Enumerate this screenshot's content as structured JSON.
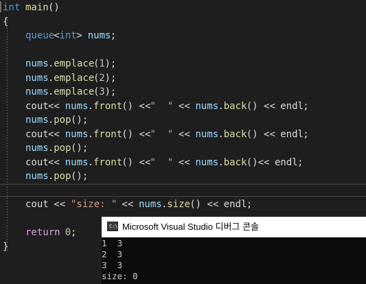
{
  "editor": {
    "lines": [
      {
        "tokens": [
          {
            "t": "int",
            "c": "kw"
          },
          {
            "t": " ",
            "c": "plain"
          },
          {
            "t": "main",
            "c": "fn"
          },
          {
            "t": "()",
            "c": "plain"
          }
        ]
      },
      {
        "tokens": [
          {
            "t": "{",
            "c": "plain"
          }
        ]
      },
      {
        "tokens": [
          {
            "t": "    ",
            "c": "plain"
          },
          {
            "t": "queue",
            "c": "kw"
          },
          {
            "t": "<",
            "c": "plain"
          },
          {
            "t": "int",
            "c": "kw"
          },
          {
            "t": "> ",
            "c": "plain"
          },
          {
            "t": "nums",
            "c": "var"
          },
          {
            "t": ";",
            "c": "plain"
          }
        ]
      },
      {
        "tokens": []
      },
      {
        "tokens": [
          {
            "t": "    ",
            "c": "plain"
          },
          {
            "t": "nums",
            "c": "var"
          },
          {
            "t": ".",
            "c": "plain"
          },
          {
            "t": "emplace",
            "c": "fn"
          },
          {
            "t": "(",
            "c": "plain"
          },
          {
            "t": "1",
            "c": "num"
          },
          {
            "t": ");",
            "c": "plain"
          }
        ]
      },
      {
        "tokens": [
          {
            "t": "    ",
            "c": "plain"
          },
          {
            "t": "nums",
            "c": "var"
          },
          {
            "t": ".",
            "c": "plain"
          },
          {
            "t": "emplace",
            "c": "fn"
          },
          {
            "t": "(",
            "c": "plain"
          },
          {
            "t": "2",
            "c": "num"
          },
          {
            "t": ");",
            "c": "plain"
          }
        ]
      },
      {
        "tokens": [
          {
            "t": "    ",
            "c": "plain"
          },
          {
            "t": "nums",
            "c": "var"
          },
          {
            "t": ".",
            "c": "plain"
          },
          {
            "t": "emplace",
            "c": "fn"
          },
          {
            "t": "(",
            "c": "plain"
          },
          {
            "t": "3",
            "c": "num"
          },
          {
            "t": ");",
            "c": "plain"
          }
        ]
      },
      {
        "tokens": [
          {
            "t": "    ",
            "c": "plain"
          },
          {
            "t": "cout",
            "c": "plain"
          },
          {
            "t": "<< ",
            "c": "plain"
          },
          {
            "t": "nums",
            "c": "var"
          },
          {
            "t": ".",
            "c": "plain"
          },
          {
            "t": "front",
            "c": "fn"
          },
          {
            "t": "() <<",
            "c": "plain"
          },
          {
            "t": "\"  \"",
            "c": "str"
          },
          {
            "t": " << ",
            "c": "plain"
          },
          {
            "t": "nums",
            "c": "var"
          },
          {
            "t": ".",
            "c": "plain"
          },
          {
            "t": "back",
            "c": "fn"
          },
          {
            "t": "() << ",
            "c": "plain"
          },
          {
            "t": "endl",
            "c": "plain"
          },
          {
            "t": ";",
            "c": "plain"
          }
        ]
      },
      {
        "tokens": [
          {
            "t": "    ",
            "c": "plain"
          },
          {
            "t": "nums",
            "c": "var"
          },
          {
            "t": ".",
            "c": "plain"
          },
          {
            "t": "pop",
            "c": "fn"
          },
          {
            "t": "();",
            "c": "plain"
          }
        ]
      },
      {
        "tokens": [
          {
            "t": "    ",
            "c": "plain"
          },
          {
            "t": "cout",
            "c": "plain"
          },
          {
            "t": "<< ",
            "c": "plain"
          },
          {
            "t": "nums",
            "c": "var"
          },
          {
            "t": ".",
            "c": "plain"
          },
          {
            "t": "front",
            "c": "fn"
          },
          {
            "t": "() <<",
            "c": "plain"
          },
          {
            "t": "\"  \"",
            "c": "str"
          },
          {
            "t": " << ",
            "c": "plain"
          },
          {
            "t": "nums",
            "c": "var"
          },
          {
            "t": ".",
            "c": "plain"
          },
          {
            "t": "back",
            "c": "fn"
          },
          {
            "t": "() << ",
            "c": "plain"
          },
          {
            "t": "endl",
            "c": "plain"
          },
          {
            "t": ";",
            "c": "plain"
          }
        ]
      },
      {
        "tokens": [
          {
            "t": "    ",
            "c": "plain"
          },
          {
            "t": "nums",
            "c": "var"
          },
          {
            "t": ".",
            "c": "plain"
          },
          {
            "t": "pop",
            "c": "fn"
          },
          {
            "t": "();",
            "c": "plain"
          }
        ]
      },
      {
        "tokens": [
          {
            "t": "    ",
            "c": "plain"
          },
          {
            "t": "cout",
            "c": "plain"
          },
          {
            "t": "<< ",
            "c": "plain"
          },
          {
            "t": "nums",
            "c": "var"
          },
          {
            "t": ".",
            "c": "plain"
          },
          {
            "t": "front",
            "c": "fn"
          },
          {
            "t": "() <<",
            "c": "plain"
          },
          {
            "t": "\"  \"",
            "c": "str"
          },
          {
            "t": " << ",
            "c": "plain"
          },
          {
            "t": "nums",
            "c": "var"
          },
          {
            "t": ".",
            "c": "plain"
          },
          {
            "t": "back",
            "c": "fn"
          },
          {
            "t": "()<< ",
            "c": "plain"
          },
          {
            "t": "endl",
            "c": "plain"
          },
          {
            "t": ";",
            "c": "plain"
          }
        ]
      },
      {
        "tokens": [
          {
            "t": "    ",
            "c": "plain"
          },
          {
            "t": "nums",
            "c": "var"
          },
          {
            "t": ".",
            "c": "plain"
          },
          {
            "t": "pop",
            "c": "fn"
          },
          {
            "t": "();",
            "c": "plain"
          }
        ]
      },
      {
        "tokens": []
      },
      {
        "tokens": [
          {
            "t": "    ",
            "c": "plain"
          },
          {
            "t": "cout",
            "c": "plain"
          },
          {
            "t": " << ",
            "c": "plain"
          },
          {
            "t": "\"size: \"",
            "c": "str"
          },
          {
            "t": " << ",
            "c": "plain"
          },
          {
            "t": "nums",
            "c": "var"
          },
          {
            "t": ".",
            "c": "plain"
          },
          {
            "t": "size",
            "c": "fn"
          },
          {
            "t": "() << ",
            "c": "plain"
          },
          {
            "t": "endl",
            "c": "plain"
          },
          {
            "t": ";",
            "c": "plain"
          }
        ]
      },
      {
        "tokens": []
      },
      {
        "tokens": [
          {
            "t": "    ",
            "c": "plain"
          },
          {
            "t": "return",
            "c": "ctrl"
          },
          {
            "t": " ",
            "c": "plain"
          },
          {
            "t": "0",
            "c": "num"
          },
          {
            "t": ";",
            "c": "plain"
          }
        ]
      },
      {
        "tokens": [
          {
            "t": "}",
            "c": "plain"
          }
        ]
      }
    ]
  },
  "console": {
    "title": "Microsoft Visual Studio 디버그 콘솔",
    "icon": "console-app-icon",
    "icon_glyph": "C:\\",
    "output": [
      "1  3",
      "2  3",
      "3  3",
      "size: 0"
    ]
  },
  "colors": {
    "editor_bg": "#1e1e1e",
    "keyword": "#569cd6",
    "function": "#dcdcaa",
    "variable": "#9cdcfe",
    "string": "#d69d85",
    "number": "#b5cea8",
    "control": "#d8a0df",
    "console_bg": "#0c0c0c",
    "console_text": "#cccccc"
  }
}
